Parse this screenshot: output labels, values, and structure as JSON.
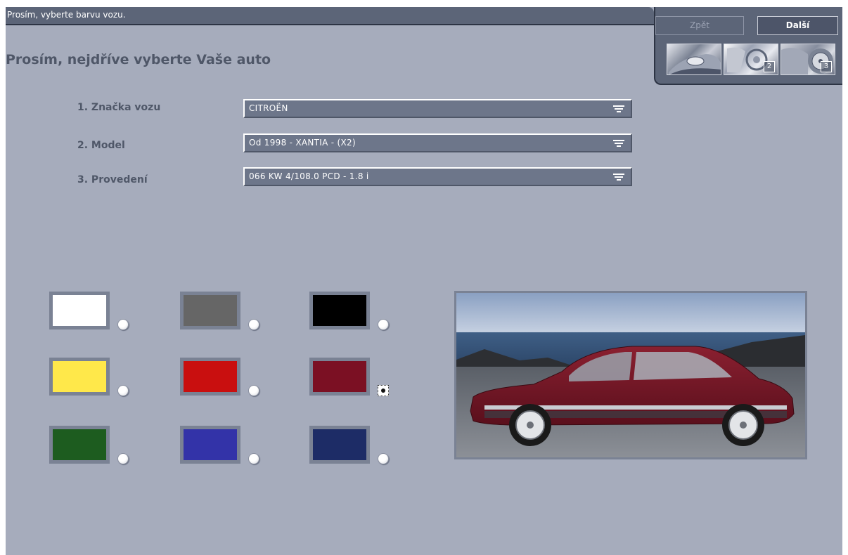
{
  "status_bar": {
    "text": "Prosím, vyberte barvu vozu."
  },
  "nav": {
    "back_label": "Zpět",
    "next_label": "Další",
    "steps": [
      "",
      "2",
      "3"
    ]
  },
  "title": "Prosím, nejdříve vyberte Vaše auto",
  "form": {
    "make_label": "1. Značka vozu",
    "make_value": "CITROËN",
    "model_label": "2. Model",
    "model_value": "Od 1998 - XANTIA - (X2)",
    "version_label": "3. Provedení",
    "version_value": "066 KW 4/108.0 PCD - 1.8 i"
  },
  "colors": [
    {
      "hex": "#ffffff",
      "selected": false
    },
    {
      "hex": "#666666",
      "selected": false
    },
    {
      "hex": "#000000",
      "selected": false
    },
    {
      "hex": "#ffe84a",
      "selected": false
    },
    {
      "hex": "#c90f0f",
      "selected": false
    },
    {
      "hex": "#7b1023",
      "selected": true
    },
    {
      "hex": "#1d5c1f",
      "selected": false
    },
    {
      "hex": "#3333a8",
      "selected": false
    },
    {
      "hex": "#1d2c66",
      "selected": false
    }
  ],
  "preview": {
    "image": "car-preview-image",
    "car_color": "#7b1023"
  },
  "theme": {
    "background": "#a6acbc",
    "panel": "#5c6578",
    "label_text": "#4f5768"
  }
}
